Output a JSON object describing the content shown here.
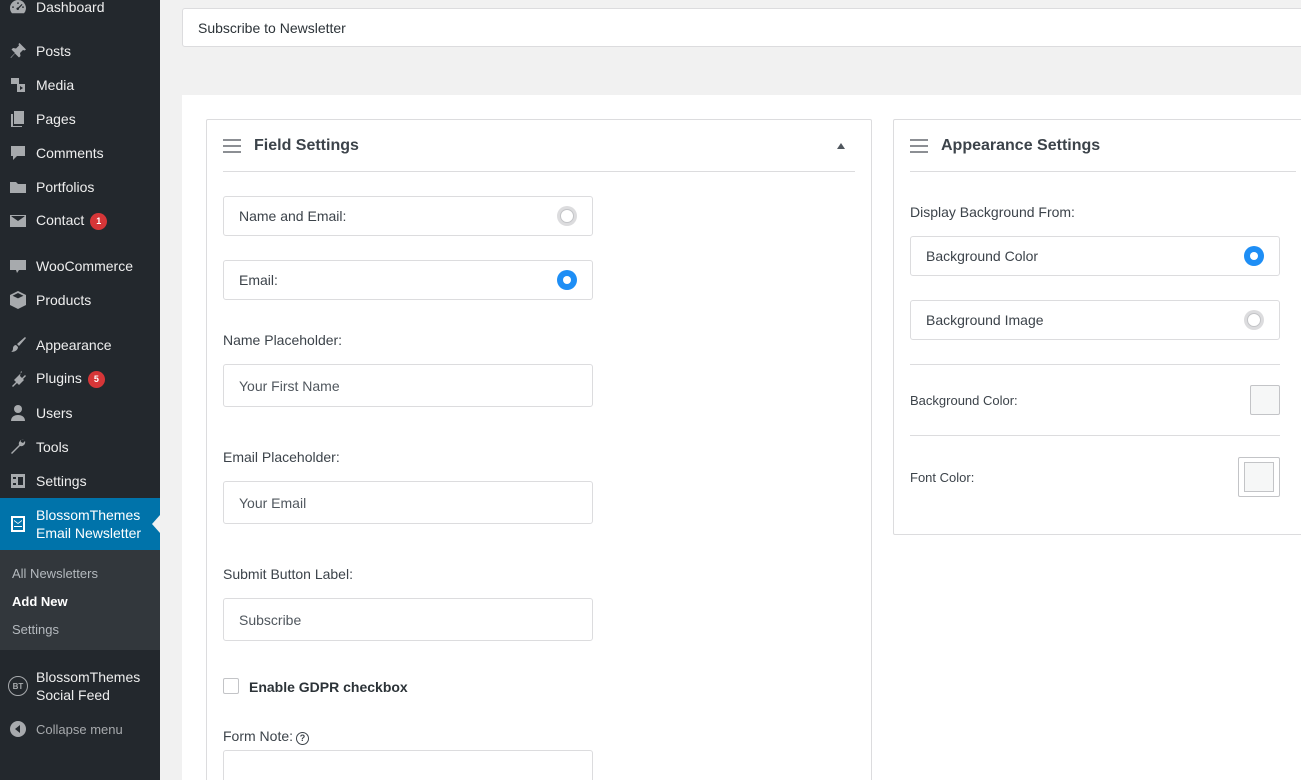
{
  "sidebar": {
    "items": [
      {
        "label": "Dashboard",
        "icon": "dashboard-icon"
      },
      {
        "label": "Posts",
        "icon": "pin-icon"
      },
      {
        "label": "Media",
        "icon": "media-icon"
      },
      {
        "label": "Pages",
        "icon": "pages-icon"
      },
      {
        "label": "Comments",
        "icon": "comment-icon"
      },
      {
        "label": "Portfolios",
        "icon": "folder-icon"
      },
      {
        "label": "Contact",
        "icon": "mail-icon",
        "badge": "1"
      },
      {
        "label": "WooCommerce",
        "icon": "woo-icon"
      },
      {
        "label": "Products",
        "icon": "box-icon"
      },
      {
        "label": "Appearance",
        "icon": "brush-icon"
      },
      {
        "label": "Plugins",
        "icon": "plug-icon",
        "badge": "5"
      },
      {
        "label": "Users",
        "icon": "user-icon"
      },
      {
        "label": "Tools",
        "icon": "wrench-icon"
      },
      {
        "label": "Settings",
        "icon": "settings-icon"
      }
    ],
    "active": {
      "line1": "BlossomThemes",
      "line2": "Email Newsletter"
    },
    "submenu": [
      "All Newsletters",
      "Add New",
      "Settings"
    ],
    "social": {
      "line1": "BlossomThemes",
      "line2": "Social Feed",
      "icon_text": "BT"
    },
    "collapse": "Collapse menu"
  },
  "title": "Subscribe to Newsletter",
  "field_settings": {
    "title": "Field Settings",
    "options": [
      "Name and Email:",
      "Email:"
    ],
    "selected": "Email:",
    "name_placeholder_label": "Name Placeholder:",
    "name_placeholder_value": "Your First Name",
    "email_placeholder_label": "Email Placeholder:",
    "email_placeholder_value": "Your Email",
    "submit_label": "Submit Button Label:",
    "submit_value": "Subscribe",
    "gdpr_label": "Enable GDPR checkbox",
    "form_note_label": "Form Note:",
    "help_glyph": "?"
  },
  "appearance_settings": {
    "title": "Appearance Settings",
    "display_from_label": "Display Background From:",
    "options": [
      "Background Color",
      "Background Image"
    ],
    "selected": "Background Color",
    "bg_color_label": "Background Color:",
    "font_color_label": "Font Color:"
  },
  "colors": {
    "sidebar_bg": "#23282d",
    "active_bg": "#0073aa",
    "badge": "#d63638",
    "radio_on": "#1e8ef5"
  }
}
